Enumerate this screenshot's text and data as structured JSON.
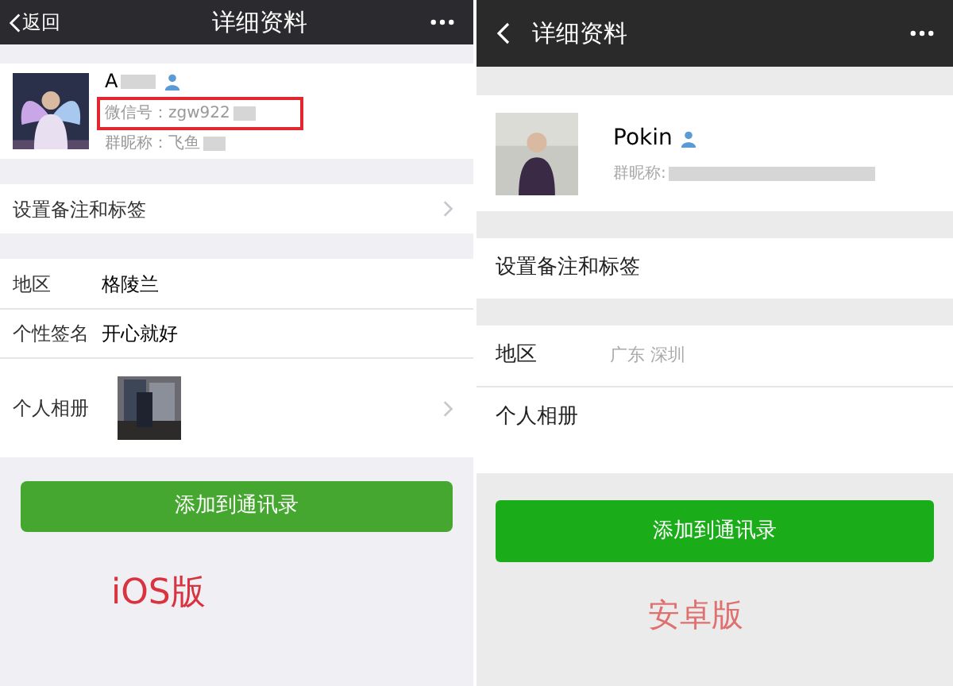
{
  "panels": [
    {
      "kind": "ios",
      "nav": {
        "back_label": "返回",
        "title": "详细资料"
      },
      "profile": {
        "name": "A",
        "name_blurred": true,
        "lines": [
          {
            "text": "微信号：zgw922",
            "highlighted": true,
            "blurred": true
          },
          {
            "text": "群昵称：飞鱼",
            "highlighted": false,
            "blurred": true
          }
        ]
      },
      "groups": [
        [
          {
            "kind": "plain",
            "label": "设置备注和标签",
            "chevron": true
          }
        ],
        [
          {
            "kind": "plain",
            "label": "地区",
            "value": "格陵兰"
          },
          {
            "kind": "plain",
            "label": "个性签名",
            "value": "开心就好"
          },
          {
            "kind": "album",
            "label": "个人相册",
            "chevron": true
          }
        ]
      ],
      "button": "添加到通讯录",
      "caption": "iOS版"
    },
    {
      "kind": "android",
      "nav": {
        "title": "详细资料"
      },
      "profile": {
        "name": "Pokin",
        "name_blurred": false,
        "lines": [
          {
            "text": "群昵称:",
            "highlighted": false,
            "blurred": true
          }
        ]
      },
      "groups": [
        [
          {
            "kind": "plain",
            "label": "设置备注和标签",
            "chevron": false
          }
        ],
        [
          {
            "kind": "plain",
            "label": "地区",
            "value": "广东 深圳"
          },
          {
            "kind": "plain",
            "label": "个人相册",
            "chevron": false
          }
        ]
      ],
      "button": "添加到通讯录",
      "caption": "安卓版"
    }
  ]
}
